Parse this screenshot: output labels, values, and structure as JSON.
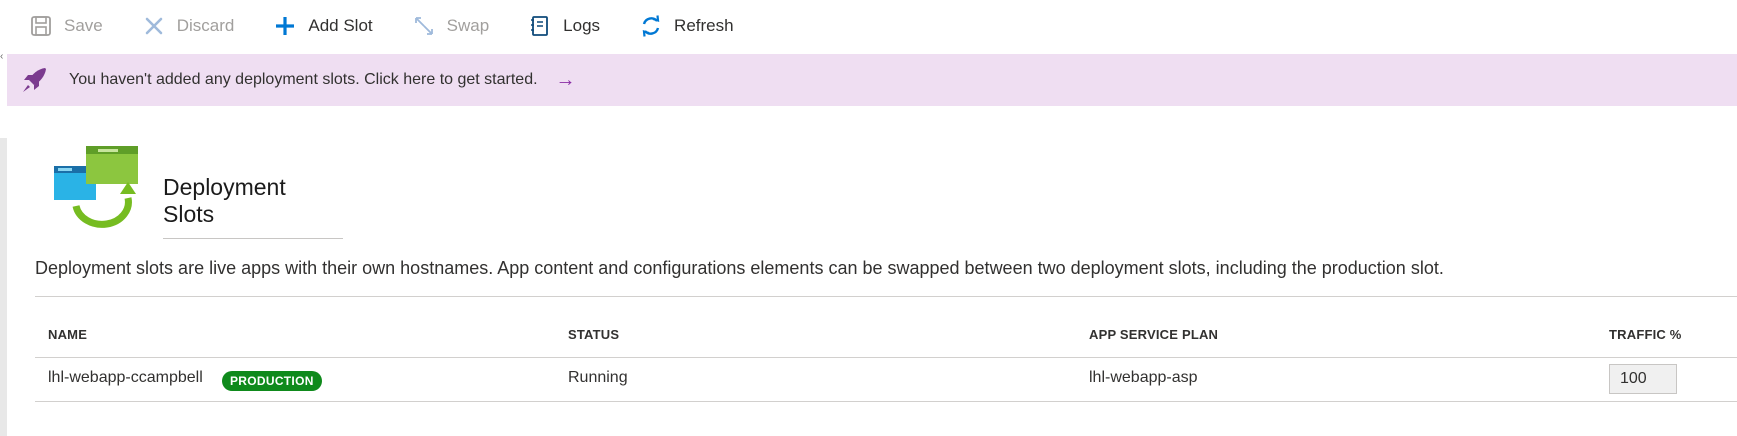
{
  "toolbar": {
    "save": "Save",
    "discard": "Discard",
    "add_slot": "Add Slot",
    "swap": "Swap",
    "logs": "Logs",
    "refresh": "Refresh"
  },
  "banner": {
    "message": "You haven't added any deployment slots. Click here to get started.",
    "arrow": "→",
    "color": "#efdef2"
  },
  "page": {
    "title": "Deployment Slots",
    "description": "Deployment slots are live apps with their own hostnames. App content and configurations elements can be swapped between two deployment slots, including the production slot."
  },
  "table": {
    "headers": [
      "NAME",
      "STATUS",
      "APP SERVICE PLAN",
      "TRAFFIC %"
    ],
    "rows": [
      {
        "name": "lhl-webapp-ccampbell",
        "badge": "PRODUCTION",
        "status": "Running",
        "plan": "lhl-webapp-asp",
        "traffic": "100"
      }
    ]
  },
  "icons": {
    "save": "save-icon",
    "discard": "close-icon",
    "add_slot": "plus-icon",
    "swap": "swap-icon",
    "logs": "logs-icon",
    "refresh": "refresh-icon",
    "banner": "rocket-icon",
    "hero": "deployment-slots-icon"
  },
  "colors": {
    "accent": "#0078d4",
    "badge": "#0f8a1c",
    "banner_arrow": "#8a2da5"
  }
}
